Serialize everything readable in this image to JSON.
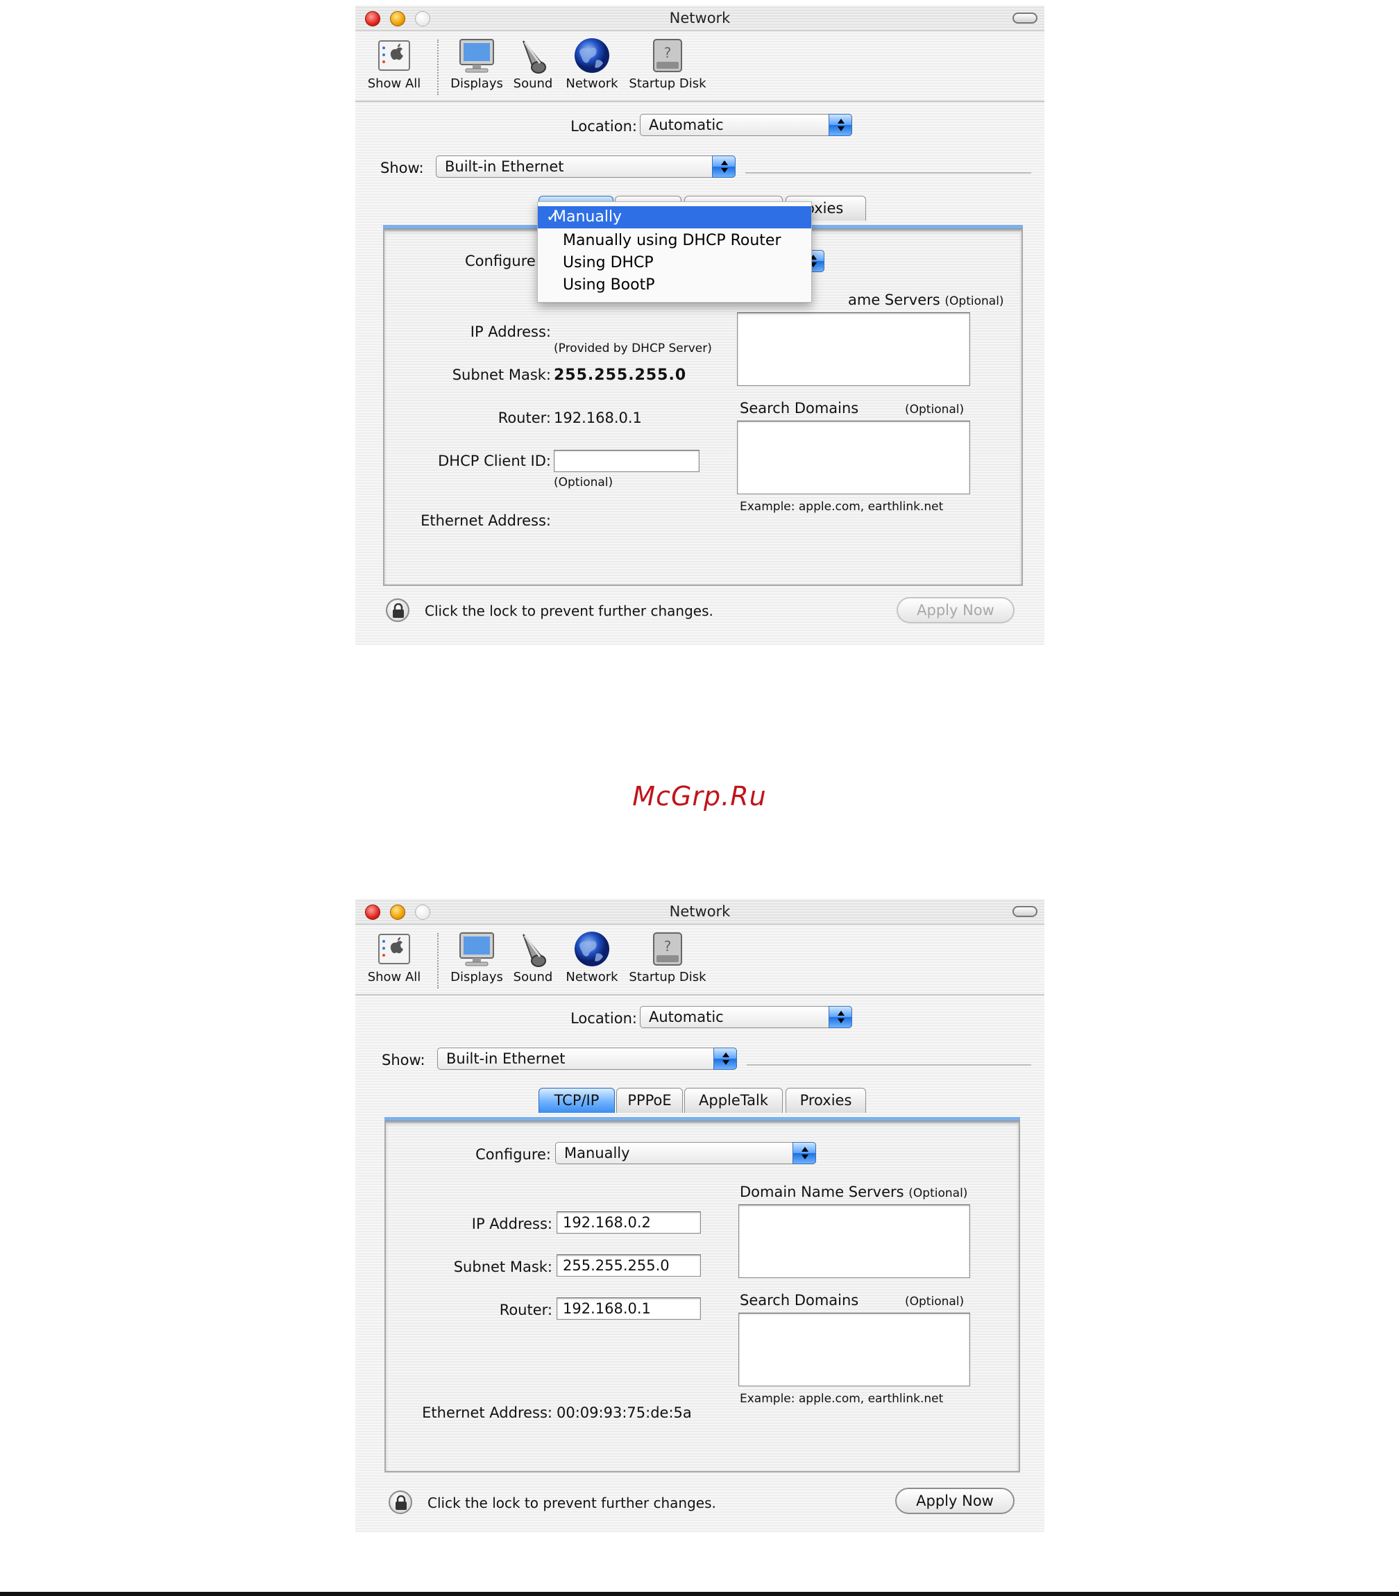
{
  "watermark": "McGrp.Ru",
  "window_title": "Network",
  "toolbar": {
    "items": [
      {
        "label": "Show All",
        "icon": "apple-icon"
      },
      {
        "label": "Displays",
        "icon": "display-icon"
      },
      {
        "label": "Sound",
        "icon": "speaker-icon"
      },
      {
        "label": "Network",
        "icon": "globe-icon"
      },
      {
        "label": "Startup Disk",
        "icon": "disk-icon"
      }
    ]
  },
  "location": {
    "label": "Location:",
    "value": "Automatic"
  },
  "show": {
    "label": "Show:",
    "value": "Built-in Ethernet"
  },
  "tabs": [
    "TCP/IP",
    "PPPoE",
    "AppleTalk",
    "Proxies"
  ],
  "tab_partial": "oxies",
  "configure_label": "Configure:",
  "configure_label_partial": "Configure",
  "configure_menu": {
    "items": [
      "Manually",
      "Manually using DHCP Router",
      "Using DHCP",
      "Using BootP"
    ],
    "checkmark": "✓"
  },
  "labels": {
    "ip_address": "IP Address:",
    "subnet_mask": "Subnet Mask:",
    "router": "Router:",
    "dhcp_client_id": "DHCP Client ID:",
    "ethernet_address": "Ethernet Address:",
    "provided_by_dhcp": "(Provided by DHCP Server)",
    "optional": "(Optional)",
    "domain_name_servers": "Domain Name Servers",
    "domain_name_servers_partial": "ame Servers",
    "search_domains": "Search Domains",
    "example": "Example: apple.com, earthlink.net"
  },
  "window1": {
    "subnet_mask": "255.255.255.0",
    "router": "192.168.0.1",
    "dhcp_client_id": ""
  },
  "window2": {
    "configure_value": "Manually",
    "ip_address": "192.168.0.2",
    "subnet_mask": "255.255.255.0",
    "router": "192.168.0.1",
    "ethernet_address": "00:09:93:75:de:5a"
  },
  "footer": {
    "lock_text": "Click the lock to prevent further changes.",
    "apply_button": "Apply Now"
  },
  "colors": {
    "selection": "#2f6fe6",
    "watermark": "#c0141a",
    "aqua_blue": "#3b8ef0"
  }
}
